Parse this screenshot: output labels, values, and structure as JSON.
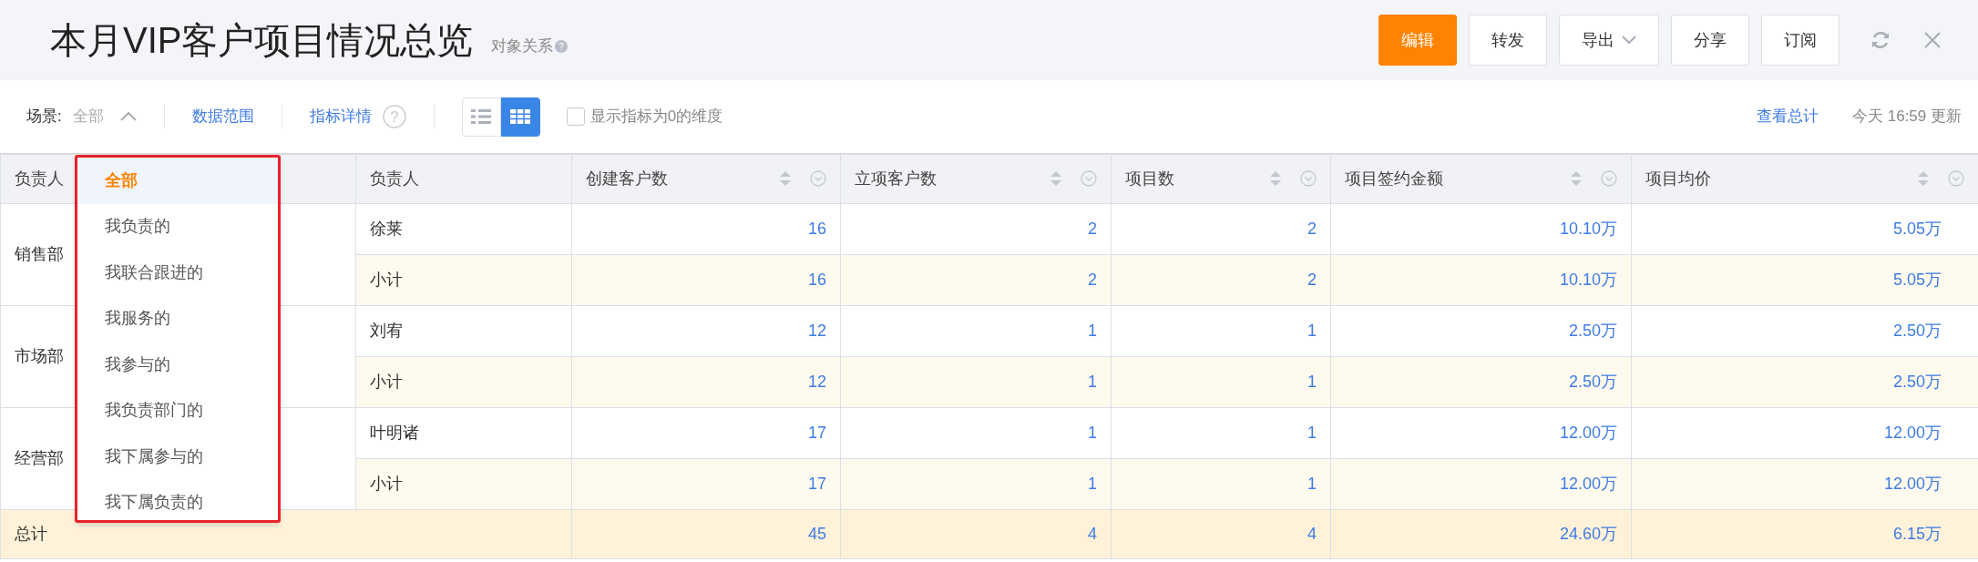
{
  "header": {
    "title": "本月VIP客户项目情况总览",
    "subtitle": "对象关系",
    "help_mark": "?",
    "buttons": [
      {
        "label": "编辑",
        "kind": "primary",
        "has_menu": false
      },
      {
        "label": "转发",
        "kind": "default",
        "has_menu": false
      },
      {
        "label": "导出",
        "kind": "default",
        "has_menu": true
      },
      {
        "label": "分享",
        "kind": "default",
        "has_menu": false
      },
      {
        "label": "订阅",
        "kind": "default",
        "has_menu": false
      }
    ]
  },
  "toolbar": {
    "scene_label": "场景:",
    "scene_value": "全部",
    "scene_expanded": true,
    "data_range": "数据范围",
    "metric_details": "指标详情",
    "help_mark": "?",
    "view_toggle": [
      {
        "kind": "list",
        "selected": false
      },
      {
        "kind": "table",
        "selected": true
      }
    ],
    "zero_checkbox": {
      "label": "显示指标为0的维度",
      "checked": false
    },
    "view_total": "查看总计",
    "updated": "今天 16:59 更新"
  },
  "scene_menu": [
    {
      "label": "全部",
      "selected": true
    },
    {
      "label": "我负责的",
      "selected": false
    },
    {
      "label": "我联合跟进的",
      "selected": false
    },
    {
      "label": "我服务的",
      "selected": false
    },
    {
      "label": "我参与的",
      "selected": false
    },
    {
      "label": "我负责部门的",
      "selected": false
    },
    {
      "label": "我下属参与的",
      "selected": false
    },
    {
      "label": "我下属负责的",
      "selected": false
    }
  ],
  "table": {
    "columns": [
      {
        "label": "负责人",
        "sortable": false
      },
      {
        "label": "负责人",
        "sortable": false
      },
      {
        "label": "创建客户数",
        "sortable": true
      },
      {
        "label": "立项客户数",
        "sortable": true
      },
      {
        "label": "项目数",
        "sortable": true
      },
      {
        "label": "项目签约金额",
        "sortable": true
      },
      {
        "label": "项目均价",
        "sortable": true
      }
    ],
    "groups": [
      {
        "department": "销售部",
        "rows": [
          {
            "kind": "person",
            "name": "徐莱",
            "values": [
              "16",
              "2",
              "2",
              "10.10万",
              "5.05万"
            ]
          },
          {
            "kind": "subtotal",
            "name": "小计",
            "values": [
              "16",
              "2",
              "2",
              "10.10万",
              "5.05万"
            ]
          }
        ]
      },
      {
        "department": "市场部",
        "rows": [
          {
            "kind": "person",
            "name": "刘宥",
            "values": [
              "12",
              "1",
              "1",
              "2.50万",
              "2.50万"
            ]
          },
          {
            "kind": "subtotal",
            "name": "小计",
            "values": [
              "12",
              "1",
              "1",
              "2.50万",
              "2.50万"
            ]
          }
        ]
      },
      {
        "department": "经营部",
        "rows": [
          {
            "kind": "person",
            "name": "叶明诸",
            "values": [
              "17",
              "1",
              "1",
              "12.00万",
              "12.00万"
            ]
          },
          {
            "kind": "subtotal",
            "name": "小计",
            "values": [
              "17",
              "1",
              "1",
              "12.00万",
              "12.00万"
            ]
          }
        ]
      }
    ],
    "total": {
      "label": "总计",
      "values": [
        "45",
        "4",
        "4",
        "24.60万",
        "6.15万"
      ]
    }
  }
}
